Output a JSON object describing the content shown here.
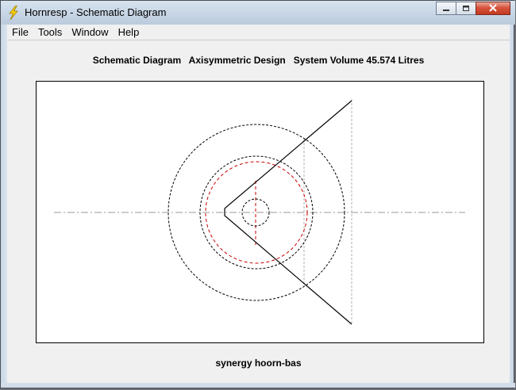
{
  "window": {
    "title": "Hornresp - Schematic Diagram",
    "app_icon": "lightning-bolt-icon",
    "controls": [
      "minimize-icon",
      "maximize-icon",
      "close-icon"
    ]
  },
  "menu": {
    "items": [
      {
        "label": "File"
      },
      {
        "label": "Tools"
      },
      {
        "label": "Window"
      },
      {
        "label": "Help"
      }
    ]
  },
  "diagram": {
    "header": "Schematic Diagram   Axisymmetric Design   System Volume 45.574 Litres",
    "footer": "synergy hoorn-bas"
  },
  "colors": {
    "outline": "#000000",
    "driver_circle": "#cc0000",
    "axis_line": "#9a9a9a"
  }
}
